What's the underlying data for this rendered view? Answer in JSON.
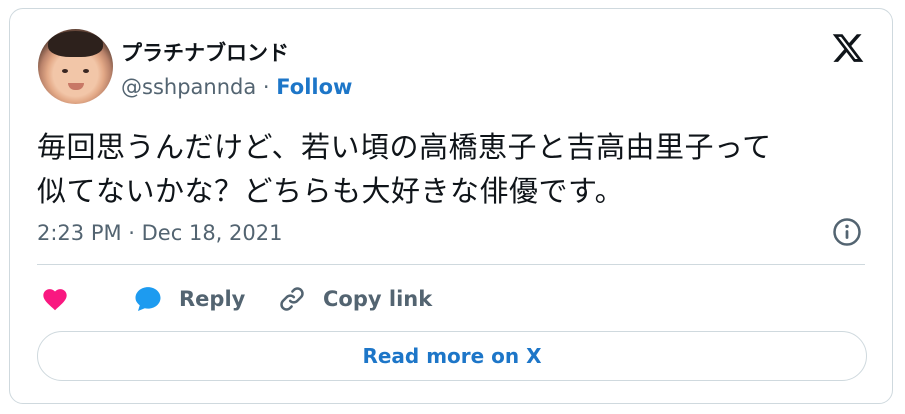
{
  "author": {
    "display_name": "プラチナブロンド",
    "handle": "@sshpannda",
    "separator": "·",
    "follow_label": "Follow"
  },
  "tweet": {
    "text_line1": "毎回思うんだけど、若い頃の高橋恵子と吉高由里子って",
    "text_line2": "似てないかな？どちらも大好きな俳優です。",
    "timestamp": "2:23 PM · Dec 18, 2021"
  },
  "actions": {
    "like_count": "",
    "reply_label": "Reply",
    "copy_link_label": "Copy link"
  },
  "read_more_label": "Read more on X",
  "colors": {
    "accent": "#1d76c8",
    "like": "#f91880",
    "reply_icon": "#1d9bf0",
    "muted": "#536471",
    "border": "#cfd9de"
  },
  "icons": [
    "x-logo-icon",
    "info-icon",
    "heart-icon",
    "reply-bubble-icon",
    "link-icon"
  ]
}
